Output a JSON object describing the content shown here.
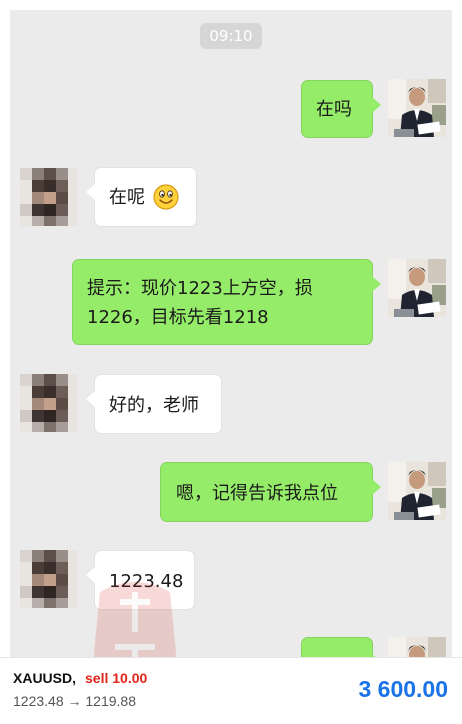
{
  "chat": {
    "time": "09:10",
    "messages": [
      {
        "side": "sent",
        "text": "在吗"
      },
      {
        "side": "recv",
        "text": "在呢",
        "emoji": "smile-emoji"
      },
      {
        "side": "sent",
        "line1": "提示：现价1223上方空，损",
        "line2": "1226，目标先看1218"
      },
      {
        "side": "recv",
        "text": "好的，老师"
      },
      {
        "side": "sent",
        "text": "嗯，记得告诉我点位"
      },
      {
        "side": "recv",
        "text": "1223.48"
      },
      {
        "side": "sent",
        "text": ""
      }
    ]
  },
  "trade": {
    "symbol": "XAUUSD,",
    "action": "sell 10.00",
    "prices": "1223.48 → 1219.88",
    "profit": "3 600.00"
  },
  "colors": {
    "sent_bubble": "#95ec69",
    "recv_bubble": "#ffffff",
    "chat_bg": "#ebebeb",
    "sell": "#e0251b",
    "profit": "#1a73e8"
  }
}
